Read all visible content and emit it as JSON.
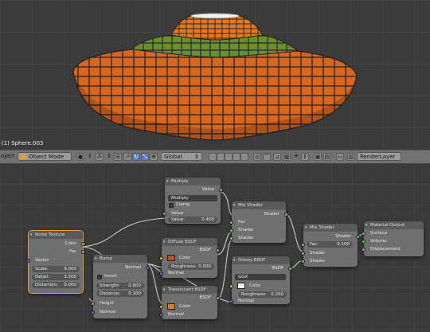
{
  "viewport": {
    "object_label": "(1) Sphere.003"
  },
  "header": {
    "cut_label": "oject",
    "mode_label": "Object Mode",
    "orientation_label": "Global",
    "render_layer_label": "RenderLayer"
  },
  "nodes": {
    "multiply": {
      "title": "Multiply",
      "out_value": "Value",
      "operation": "Multiply",
      "clamp_label": "Clamp",
      "in_value": "Value",
      "field_label": "Value:",
      "field_value": "0.400"
    },
    "mix_shader_1": {
      "title": "Mix Shader",
      "out": "Shader",
      "fac": "Fac",
      "shader_a": "Shader",
      "shader_b": "Shader"
    },
    "mix_shader_2": {
      "title": "Mix Shader",
      "out": "Shader",
      "fac_label": "Fac:",
      "fac_value": "0.100",
      "shader_a": "Shader",
      "shader_b": "Shader"
    },
    "material_output": {
      "title": "Material Output",
      "surface": "Surface",
      "volume": "Volume",
      "displacement": "Displacement"
    },
    "noise_texture": {
      "title": "Noise Texture",
      "out_color": "Color",
      "out_fac": "Fac",
      "vector": "Vector",
      "scale_label": "Scale:",
      "scale_value": "9.000",
      "detail_label": "Detail:",
      "detail_value": "3.500",
      "distortion_label": "Distortion:",
      "distortion_value": "0.000"
    },
    "bump": {
      "title": "Bump",
      "out_normal": "Normal",
      "invert_label": "Invert",
      "strength_label": "Strength:",
      "strength_value": "0.600",
      "distance_label": "Distance:",
      "distance_value": "0.100",
      "height": "Height",
      "normal": "Normal"
    },
    "diffuse": {
      "title": "Diffuse BSDF",
      "out": "BSDF",
      "color": "Color",
      "roughness_label": "Roughness:",
      "roughness_value": "0.000",
      "normal": "Normal",
      "color_hex": "#b5541e"
    },
    "glossy": {
      "title": "Glossy BSDF",
      "out": "BSDF",
      "distribution": "GGX",
      "color": "Color",
      "roughness_label": "Roughness:",
      "roughness_value": "0.200",
      "normal": "Normal",
      "color_hex": "#f0f0f0"
    },
    "translucent": {
      "title": "Translucent BSDF",
      "out": "BSDF",
      "color": "Color",
      "normal": "Normal",
      "color_hex": "#e07a1c"
    }
  },
  "colors": {
    "shade_orange": "#d8661e",
    "shade_green": "#6a8f2c",
    "shade_lead": "#2a2a2a",
    "accent_blue": "#5680c2"
  }
}
